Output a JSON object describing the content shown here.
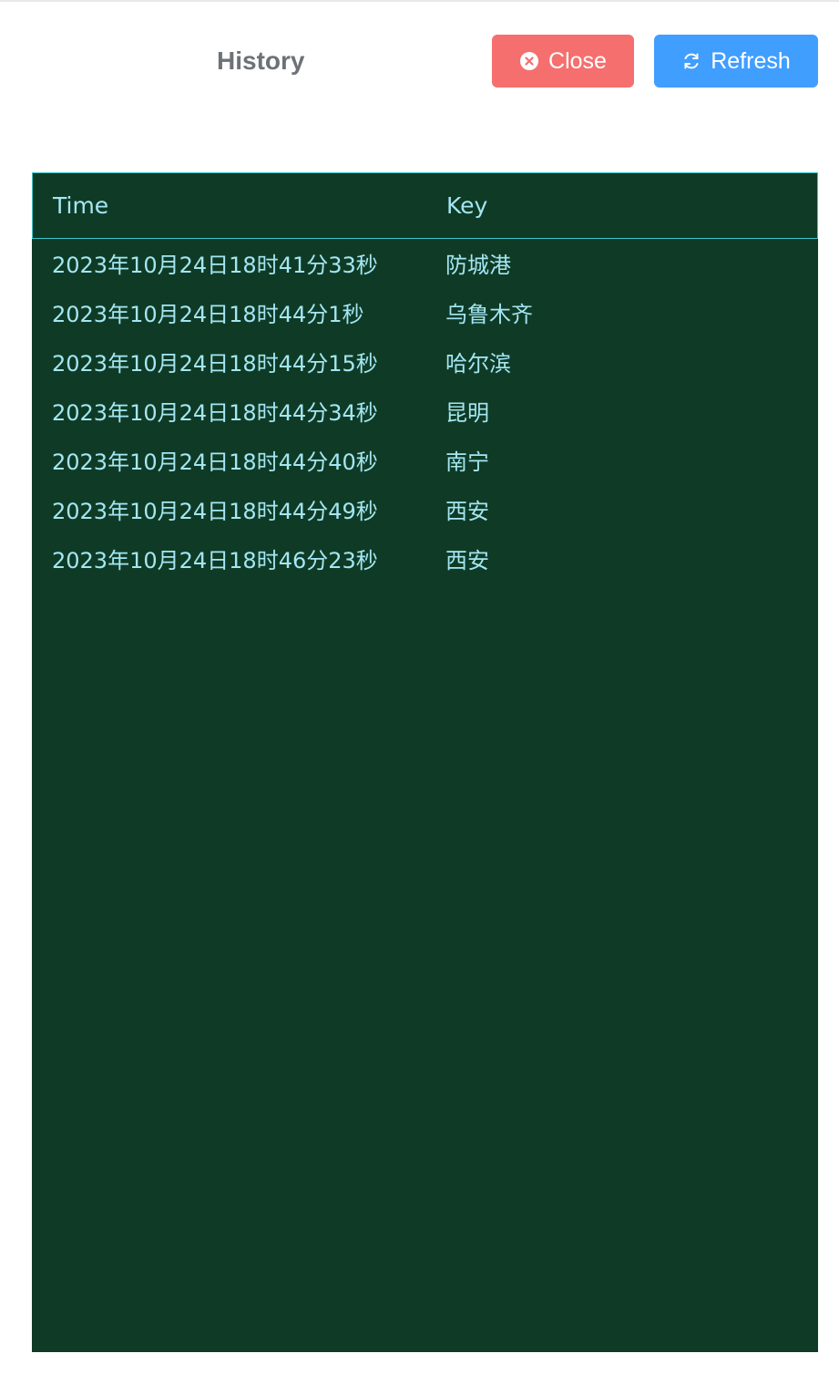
{
  "header": {
    "title": "History",
    "close_label": "Close",
    "refresh_label": "Refresh"
  },
  "colors": {
    "close_button": "#f56f6f",
    "refresh_button": "#409eff",
    "table_background": "#0f3b26",
    "table_text": "#a4e6f2",
    "header_border": "#3fc6c9",
    "title_text": "#6e7178"
  },
  "icons": {
    "close": "circle-x-icon",
    "refresh": "refresh-icon"
  },
  "table": {
    "columns": [
      "Time",
      "Key"
    ],
    "rows": [
      {
        "time": "2023年10月24日18时41分33秒",
        "key": "防城港"
      },
      {
        "time": "2023年10月24日18时44分1秒",
        "key": "乌鲁木齐"
      },
      {
        "time": "2023年10月24日18时44分15秒",
        "key": "哈尔滨"
      },
      {
        "time": "2023年10月24日18时44分34秒",
        "key": "昆明"
      },
      {
        "time": "2023年10月24日18时44分40秒",
        "key": "南宁"
      },
      {
        "time": "2023年10月24日18时44分49秒",
        "key": "西安"
      },
      {
        "time": "2023年10月24日18时46分23秒",
        "key": "西安"
      }
    ]
  }
}
